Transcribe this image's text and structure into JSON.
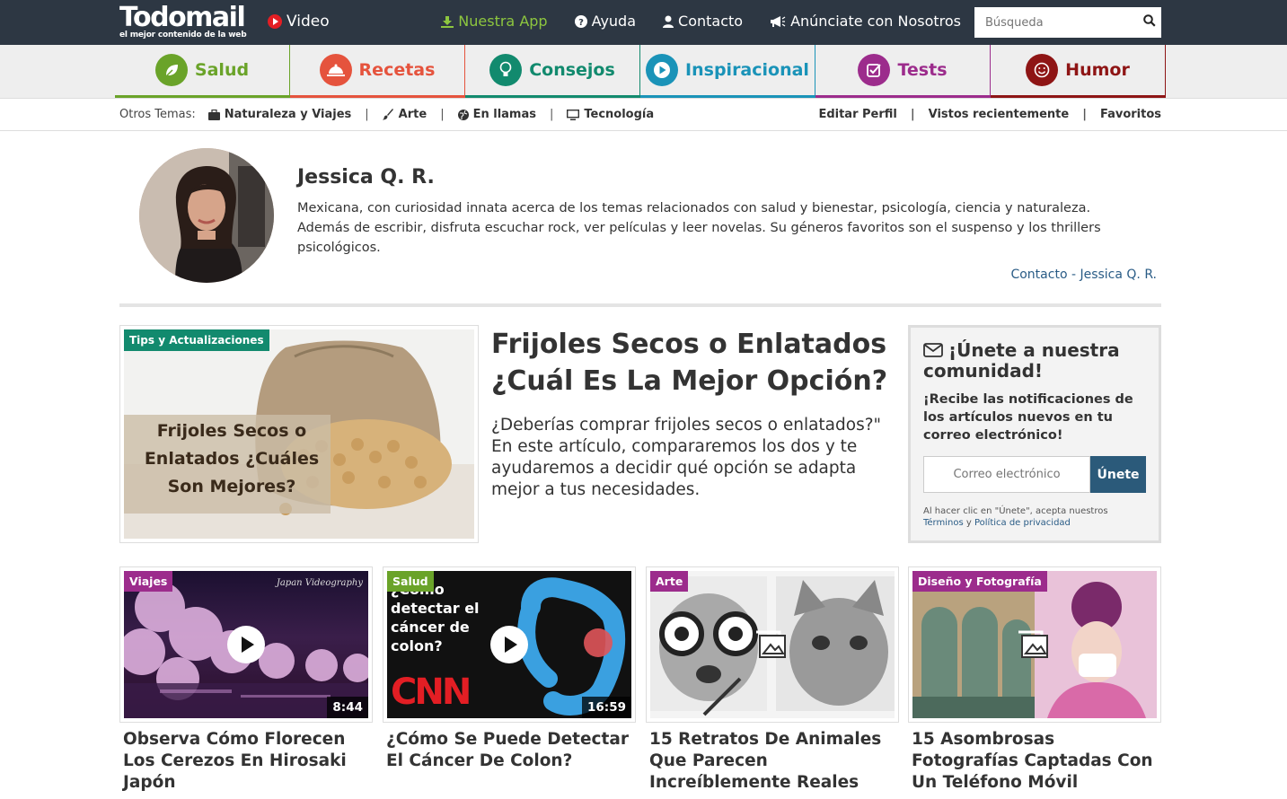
{
  "header": {
    "logo_main": "Todomail",
    "logo_sub": "el mejor contenido de la web",
    "video_label": "Video",
    "links": [
      {
        "label": "Nuestra App",
        "icon": "download-icon"
      },
      {
        "label": "Ayuda",
        "icon": "question-icon"
      },
      {
        "label": "Contacto",
        "icon": "user-icon"
      },
      {
        "label": "Anúnciate con Nosotros",
        "icon": "megaphone-icon"
      }
    ],
    "search_placeholder": "Búsqueda"
  },
  "categories": [
    {
      "label": "Salud",
      "color": "#6aa329",
      "icon": "leaf-icon"
    },
    {
      "label": "Recetas",
      "color": "#e5533d",
      "icon": "cloche-icon"
    },
    {
      "label": "Consejos",
      "color": "#128a6e",
      "icon": "lightbulb-icon"
    },
    {
      "label": "Inspiracional",
      "color": "#1a93b8",
      "icon": "play-icon"
    },
    {
      "label": "Tests",
      "color": "#9c2c8c",
      "icon": "checkbox-icon"
    },
    {
      "label": "Humor",
      "color": "#8e1515",
      "icon": "smile-icon"
    }
  ],
  "subnav": {
    "label": "Otros Temas:",
    "topics": [
      {
        "label": "Naturaleza y Viajes",
        "icon": "suitcase-icon"
      },
      {
        "label": "Arte",
        "icon": "brush-icon"
      },
      {
        "label": "En llamas",
        "icon": "globe-icon"
      },
      {
        "label": "Tecnología",
        "icon": "monitor-icon"
      }
    ],
    "right": [
      "Editar Perfil",
      "Vistos recientemente",
      "Favoritos"
    ]
  },
  "profile": {
    "name": "Jessica Q. R.",
    "bio": "Mexicana, con curiosidad innata acerca de los temas relacionados con salud y bienestar, psicología, ciencia y naturaleza. Además de escribir, disfruta escuchar rock, ver películas y leer novelas. Su géneros favoritos son el suspenso y los thrillers psicológicos.",
    "contact": "Contacto - Jessica Q. R."
  },
  "featured": {
    "tag": "Tips y Actualizaciones",
    "tag_color": "#128a6e",
    "image_text": "Frijoles Secos o Enlatados ¿Cuáles Son Mejores?",
    "title": "Frijoles Secos o Enlatados ¿Cuál Es La Mejor Opción?",
    "description": "¿Deberías comprar frijoles secos o enlatados?\" En este artículo, compararemos los dos y te ayudaremos a decidir qué opción se adapta mejor a tus necesidades."
  },
  "newsletter": {
    "title": "¡Únete a nuestra comunidad!",
    "subtitle": "¡Recibe las notificaciones de los artículos nuevos en tu correo electrónico!",
    "placeholder": "Correo electrónico",
    "button": "Únete",
    "terms_prefix": "Al hacer clic en \"Únete\", acepta nuestros",
    "terms_link1": "Términos",
    "terms_and": "y",
    "terms_link2": "Política de privacidad"
  },
  "cards": [
    {
      "tag": "Viajes",
      "tag_color": "#9c2c8c",
      "title": "Observa Cómo Florecen Los Cerezos En Hirosaki Japón",
      "duration": "8:44",
      "watermark": "Japan Videography",
      "type": "video"
    },
    {
      "tag": "Salud",
      "tag_color": "#6aa329",
      "title": "¿Cómo Se Puede Detectar El Cáncer De Colon?",
      "duration": "16:59",
      "overlay": "¿Cómo detectar el cáncer de colon?",
      "brand": "CNN",
      "type": "video"
    },
    {
      "tag": "Arte",
      "tag_color": "#9c2c8c",
      "title": "15 Retratos De Animales Que Parecen Increíblemente Reales",
      "type": "gallery"
    },
    {
      "tag": "Diseño y Fotografía",
      "tag_color": "#9c2c8c",
      "title": "15 Asombrosas Fotografías Captadas Con Un Teléfono Móvil",
      "type": "gallery"
    }
  ]
}
